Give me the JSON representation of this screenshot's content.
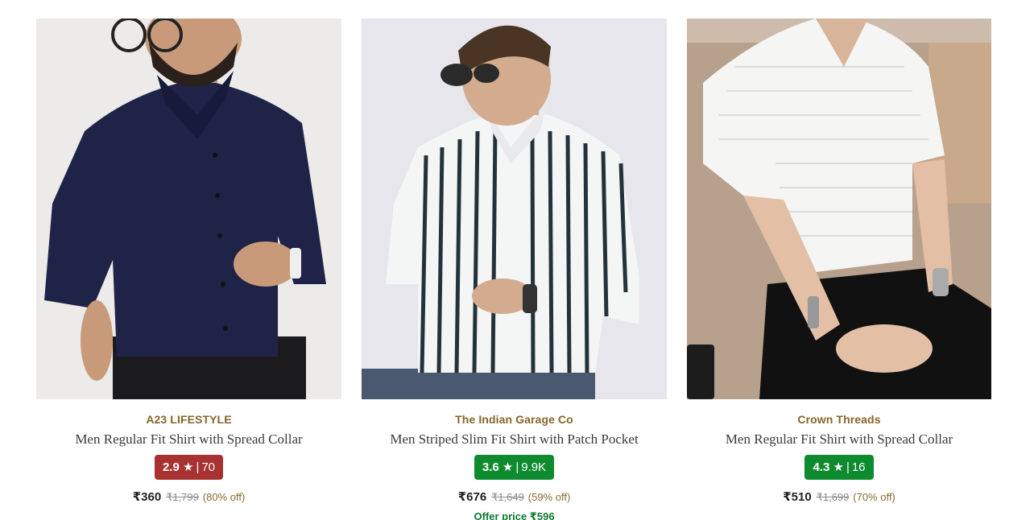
{
  "products": [
    {
      "brand": "A23 LIFESTYLE",
      "title": "Men Regular Fit Shirt with Spread Collar",
      "rating": "2.9",
      "rating_count": "70",
      "rating_color": "#a83232",
      "price": "₹360",
      "mrp": "₹1,799",
      "discount": "(80% off)",
      "image_desc": "navy-shirt-model"
    },
    {
      "brand": "The Indian Garage Co",
      "title": "Men Striped Slim Fit Shirt with Patch Pocket",
      "rating": "3.6",
      "rating_count": "9.9K",
      "rating_color": "#0e8a2f",
      "price": "₹676",
      "mrp": "₹1,649",
      "discount": "(59% off)",
      "offer": "Offer price ₹596",
      "image_desc": "striped-shirt-model"
    },
    {
      "brand": "Crown Threads",
      "title": "Men Regular Fit Shirt with Spread Collar",
      "rating": "4.3",
      "rating_count": "16",
      "rating_color": "#0e8a2f",
      "price": "₹510",
      "mrp": "₹1,699",
      "discount": "(70% off)",
      "image_desc": "white-textured-shirt-model"
    }
  ],
  "icons": {
    "star": "star-icon"
  }
}
